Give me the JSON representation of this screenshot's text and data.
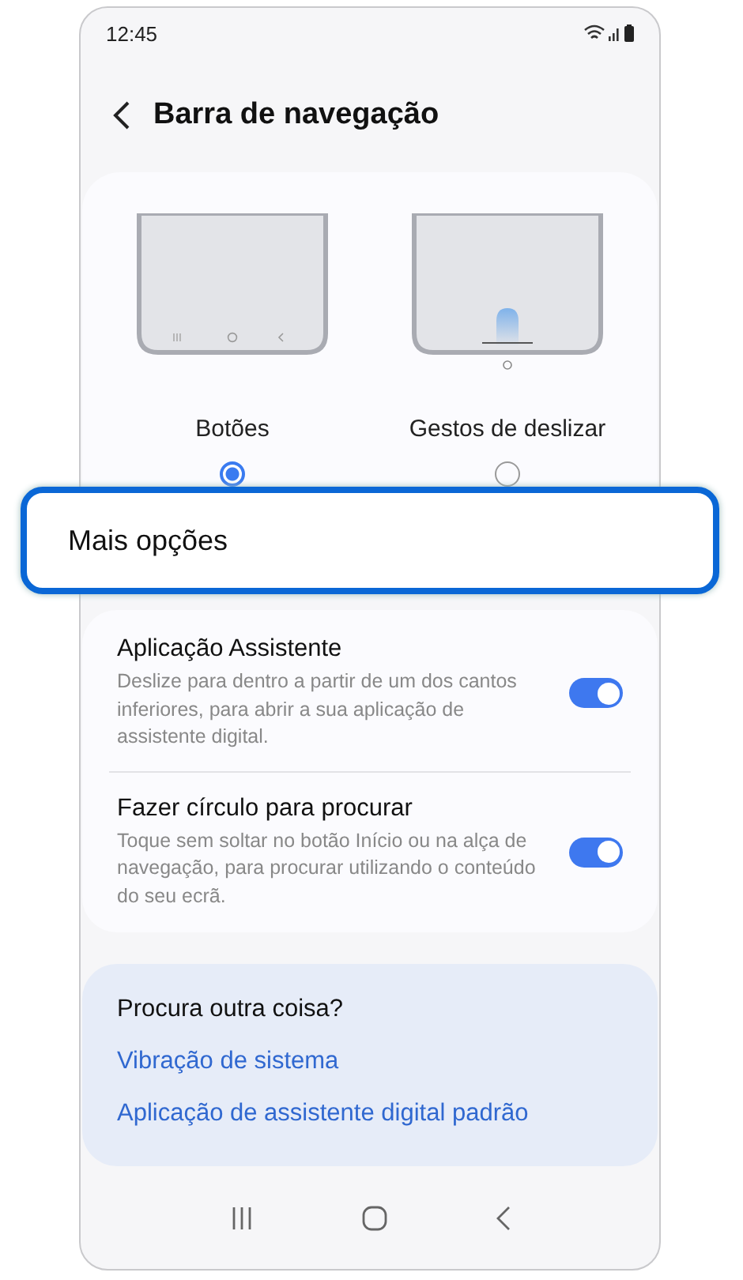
{
  "status_bar": {
    "time": "12:45"
  },
  "header": {
    "title": "Barra de navegação"
  },
  "nav_types": [
    {
      "kind": "buttons",
      "label": "Botões",
      "selected": true
    },
    {
      "kind": "gestures",
      "label": "Gestos de deslizar",
      "selected": false
    }
  ],
  "more_options": {
    "label": "Mais opções"
  },
  "settings": [
    {
      "title": "Aplicação Assistente",
      "description": "Deslize para dentro a partir de um dos cantos inferiores, para abrir a sua aplicação de assistente digital.",
      "on": true
    },
    {
      "title": "Fazer círculo para procurar",
      "description": "Toque sem soltar no botão Início ou na alça de navegação, para procurar utilizando o conteúdo do seu ecrã.",
      "on": true
    }
  ],
  "related": {
    "heading": "Procura outra coisa?",
    "links": [
      "Vibração de sistema",
      "Aplicação de assistente digital padrão"
    ]
  }
}
